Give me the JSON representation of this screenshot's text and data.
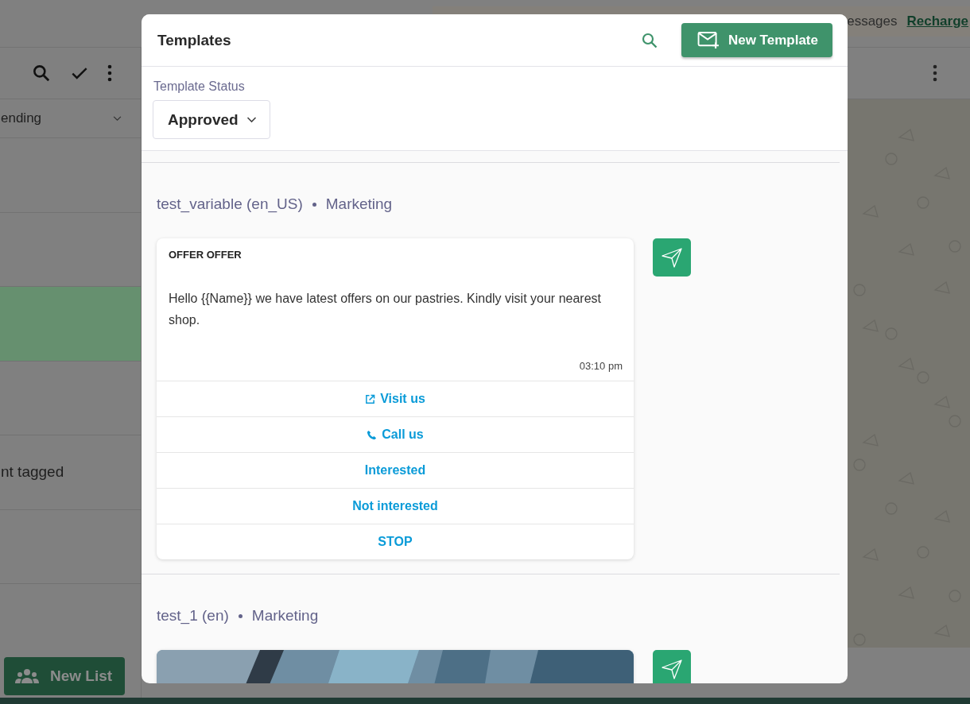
{
  "background": {
    "banner_text": "essages",
    "recharge_link": "Recharge",
    "filter": "ending",
    "rows": [
      {
        "selected": false
      },
      {
        "selected": false
      },
      {
        "selected": true
      },
      {
        "selected": false
      },
      {
        "selected": false,
        "label": "nt tagged"
      },
      {
        "selected": false
      }
    ],
    "new_list_button": "New List"
  },
  "modal": {
    "title": "Templates",
    "new_button": "New Template",
    "status_label": "Template Status",
    "status_value": "Approved",
    "templates": [
      {
        "name": "test_variable (en_US)",
        "category": "Marketing",
        "header": {
          "kind": "text",
          "text": "OFFER OFFER"
        },
        "body": "Hello {{Name}} we have latest offers on our pastries. Kindly visit your nearest shop.",
        "time": "03:10 pm",
        "buttons": [
          {
            "kind": "url",
            "label": "Visit us"
          },
          {
            "kind": "phone",
            "label": "Call us"
          },
          {
            "kind": "reply",
            "label": "Interested"
          },
          {
            "kind": "reply",
            "label": "Not interested"
          },
          {
            "kind": "reply",
            "label": "STOP"
          }
        ]
      },
      {
        "name": "test_1 (en)",
        "category": "Marketing"
      }
    ]
  }
}
